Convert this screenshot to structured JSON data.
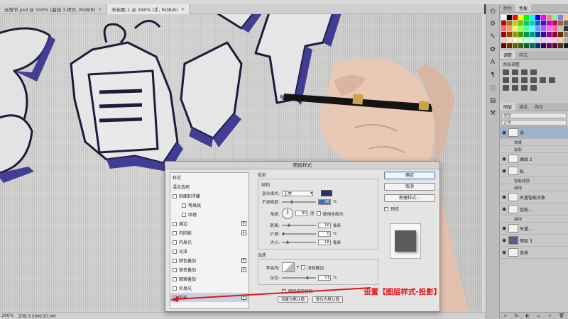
{
  "tabs": [
    {
      "label": "元宵节.psd @ 100% (曲线 3 拷贝, RGB/8)",
      "active": false
    },
    {
      "label": "未标题-1 @ 296% (手, RGB/8)",
      "active": true
    }
  ],
  "status": {
    "zoom": "296%",
    "doc": "文档:3.00M/30.0M"
  },
  "colors_panel": {
    "tabs": [
      "颜色",
      "色板"
    ],
    "active": "色板"
  },
  "adjust_panel": {
    "tabs": [
      "调整",
      "样式"
    ],
    "title": "添加调整"
  },
  "layers_panel": {
    "tabs": [
      "图层",
      "通道",
      "路径"
    ],
    "filter": "类型",
    "blend": "正常",
    "opacity": "不透明度",
    "fill": "填充",
    "rows": [
      {
        "name": "手",
        "type": "layer",
        "selected": true
      },
      {
        "name": "效果",
        "type": "sub"
      },
      {
        "name": "投影",
        "type": "sub"
      },
      {
        "name": "曲线 2",
        "type": "layer",
        "selected": false
      },
      {
        "name": "纸",
        "type": "layer",
        "selected": false
      },
      {
        "name": "智能滤镜",
        "type": "sub"
      },
      {
        "name": "曲线",
        "type": "sub"
      },
      {
        "name": "矢量智能对象",
        "type": "layer",
        "selected": false
      },
      {
        "name": "智能...",
        "type": "layer",
        "selected": false
      },
      {
        "name": "曲线",
        "type": "sub"
      },
      {
        "name": "矢量...",
        "type": "layer",
        "selected": false
      },
      {
        "name": "图层 3",
        "type": "layer",
        "selected": false
      },
      {
        "name": "背景",
        "type": "layer",
        "selected": false
      }
    ]
  },
  "dialog": {
    "title": "图层样式",
    "styles_header": "样式",
    "blend_options": "混合选项",
    "style_items": [
      {
        "label": "斜面和浮雕",
        "checked": false,
        "plus": false,
        "indent": false
      },
      {
        "label": "等高线",
        "checked": false,
        "plus": false,
        "indent": true
      },
      {
        "label": "纹理",
        "checked": false,
        "plus": false,
        "indent": true
      },
      {
        "label": "描边",
        "checked": false,
        "plus": true,
        "indent": false
      },
      {
        "label": "内阴影",
        "checked": false,
        "plus": true,
        "indent": false
      },
      {
        "label": "内发光",
        "checked": false,
        "plus": false,
        "indent": false
      },
      {
        "label": "光泽",
        "checked": false,
        "plus": false,
        "indent": false
      },
      {
        "label": "颜色叠加",
        "checked": false,
        "plus": true,
        "indent": false
      },
      {
        "label": "渐变叠加",
        "checked": false,
        "plus": true,
        "indent": false
      },
      {
        "label": "图案叠加",
        "checked": false,
        "plus": false,
        "indent": false
      },
      {
        "label": "外发光",
        "checked": false,
        "plus": false,
        "indent": false
      },
      {
        "label": "投影",
        "checked": true,
        "plus": true,
        "indent": false,
        "selected": true
      }
    ],
    "section_title": "投影",
    "structure_title": "结构",
    "blend_mode_label": "混合模式:",
    "blend_mode": "正常",
    "shadow_color": "#2e2e6e",
    "opacity_label": "不透明度:",
    "opacity": "26",
    "angle_label": "角度:",
    "angle": "90",
    "global_light": "使用全局光",
    "distance_label": "距离:",
    "distance": "16",
    "spread_label": "扩展:",
    "spread": "0",
    "size_label": "大小:",
    "size": "18",
    "percent": "%",
    "degree": "度",
    "px": "像素",
    "quality_title": "品质",
    "contour_label": "等高线:",
    "antialias": "消除锯齿",
    "noise_label": "杂色:",
    "noise": "71",
    "knockout": "图层挖空投影",
    "set_default": "设置为默认值",
    "reset_default": "复位为默认值",
    "ok": "确定",
    "cancel": "取消",
    "new_style": "新建样式...",
    "preview": "预览"
  },
  "annotation": {
    "text": "设置【图层样式-投影】",
    "color": "#e0161c"
  }
}
